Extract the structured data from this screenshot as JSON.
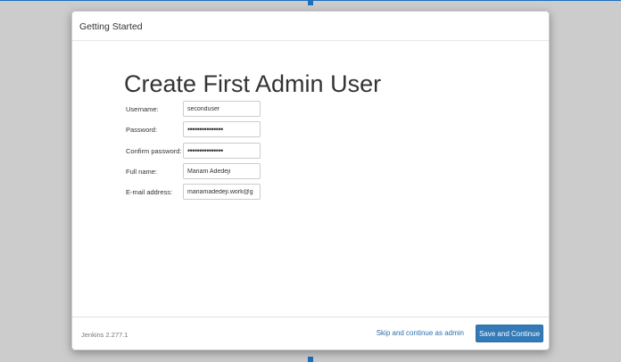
{
  "dialog": {
    "header_title": "Getting Started",
    "page_title": "Create First Admin User"
  },
  "form": {
    "username": {
      "label": "Username:",
      "value": "seconduser"
    },
    "password": {
      "label": "Password:",
      "value": "•••••••••••••••"
    },
    "confirm_password": {
      "label": "Confirm password:",
      "value": "•••••••••••••••"
    },
    "full_name": {
      "label": "Full name:",
      "value": "Mariam Adedeji"
    },
    "email": {
      "label": "E-mail address:",
      "value": "mariamadedeji.work@g"
    }
  },
  "footer": {
    "version": "Jenkins 2.277.1",
    "skip_label": "Skip and continue as admin",
    "save_label": "Save and Continue"
  },
  "colors": {
    "backdrop": "#cccccc",
    "primary_button": "#337ab7",
    "link": "#2f6fab",
    "selection_handle": "#1f6fbf"
  }
}
